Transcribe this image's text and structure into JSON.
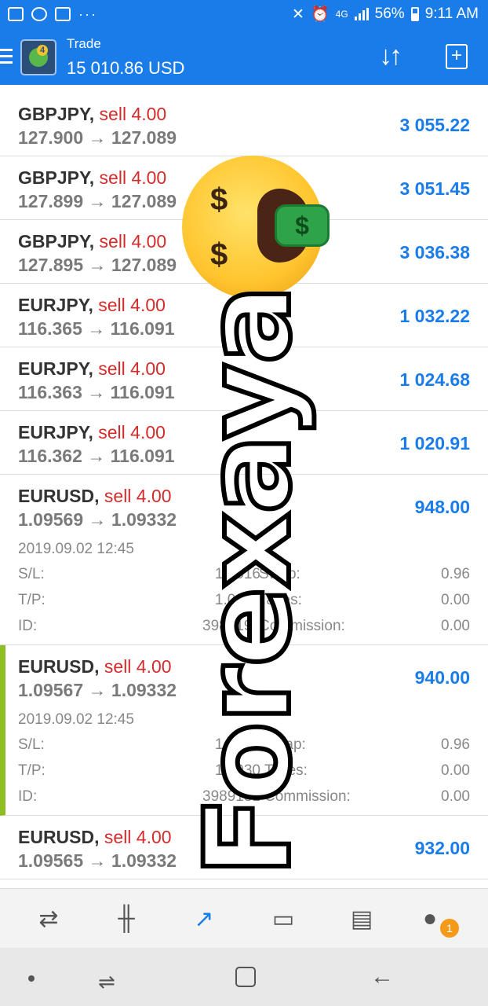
{
  "status_bar": {
    "network": "4G",
    "battery": "56%",
    "time": "9:11 AM",
    "more": "···"
  },
  "app_bar": {
    "title": "Trade",
    "balance": "15 010.86 USD"
  },
  "trades": [
    {
      "symbol": "GBPJPY,",
      "side": "sell 4.00",
      "prices": "127.900 → 127.089",
      "profit": "3 055.22"
    },
    {
      "symbol": "GBPJPY,",
      "side": "sell 4.00",
      "prices": "127.899 → 127.089",
      "profit": "3 051.45"
    },
    {
      "symbol": "GBPJPY,",
      "side": "sell 4.00",
      "prices": "127.895 → 127.089",
      "profit": "3 036.38"
    },
    {
      "symbol": "EURJPY,",
      "side": "sell 4.00",
      "prices": "116.365 → 116.091",
      "profit": "1 032.22"
    },
    {
      "symbol": "EURJPY,",
      "side": "sell 4.00",
      "prices": "116.363 → 116.091",
      "profit": "1 024.68"
    },
    {
      "symbol": "EURJPY,",
      "side": "sell 4.00",
      "prices": "116.362 → 116.091",
      "profit": "1 020.91"
    },
    {
      "symbol": "EURUSD,",
      "side": "sell 4.00",
      "prices": "1.09569 → 1.09332",
      "profit": "948.00",
      "date": "2019.09.02 12:45",
      "sl_label": "S/L:",
      "sl_value": "1.1016",
      "swap_label": "Swap:",
      "swap_value": "0.96",
      "tp_label": "T/P:",
      "tp_value": "1.0900",
      "taxes_label": "Taxes:",
      "taxes_value": "0.00",
      "id_label": "ID:",
      "id_value": "3989190",
      "commission_label": "Commission:",
      "commission_value": "0.00"
    },
    {
      "symbol": "EURUSD,",
      "side": "sell 4.00",
      "prices": "1.09567 → 1.09332",
      "profit": "940.00",
      "date": "2019.09.02 12:45",
      "sl_label": "S/L:",
      "sl_value": "1.1018",
      "swap_label": "Swap:",
      "swap_value": "0.96",
      "tp_label": "T/P:",
      "tp_value": "1.0930",
      "taxes_label": "Taxes:",
      "taxes_value": "0.00",
      "id_label": "ID:",
      "id_value": "3989181",
      "commission_label": "Commission:",
      "commission_value": "0.00"
    },
    {
      "symbol": "EURUSD,",
      "side": "sell 4.00",
      "prices": "1.09565 → 1.09332",
      "profit": "932.00"
    }
  ],
  "overlay": {
    "watermark": "Forexaya",
    "emoji": "money-mouth-face"
  },
  "bottom_nav": {
    "active": "trade",
    "chat_badge": "1"
  },
  "colors": {
    "primary": "#1a7ce8",
    "sell": "#d42b2b",
    "profit": "#1a7ce8",
    "active_marker": "#8dbf22",
    "badge": "#f39a1a"
  }
}
